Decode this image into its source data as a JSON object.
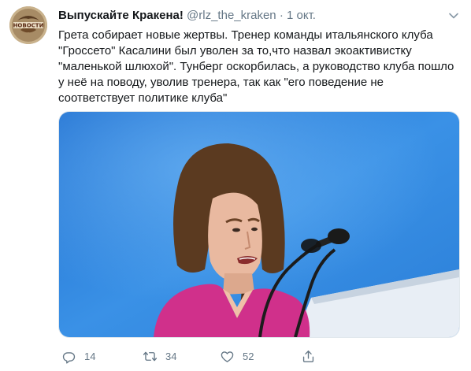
{
  "tweet": {
    "display_name": "Выпускайте Кракена!",
    "handle": "@rlz_the_kraken",
    "separator": "·",
    "time": "1 окт.",
    "text_lines": [
      "Грета собирает новые жертвы. Тренер команды итальянского клуба",
      "\"Гроссето\" Касалини был уволен за то,что назвал экоактивистку",
      "\"маленькой шлюхой\". Тунберг оскорбилась, а руководство клуба пошло",
      "у неё на поводу, уволив тренера, так как \"его поведение не",
      "соответствует политике клуба\""
    ],
    "avatar_text": "НОВОСТИ",
    "stats": {
      "replies": "14",
      "retweets": "34",
      "likes": "52"
    }
  },
  "colors": {
    "text": "#14171a",
    "secondary": "#657786",
    "border": "#e1e8ed",
    "photo_background": "#2f86dc",
    "shirt": "#d0308b"
  },
  "icons": {
    "reply": "reply-icon",
    "retweet": "retweet-icon",
    "like": "like-icon",
    "share": "share-icon",
    "caret": "chevron-down-icon"
  }
}
